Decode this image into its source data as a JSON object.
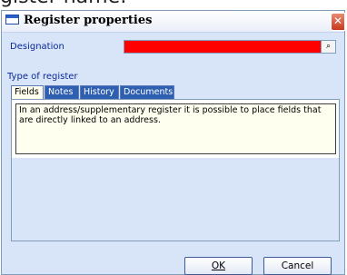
{
  "background_text": "gister name:",
  "window": {
    "title": "Register properties",
    "close_glyph": "✕"
  },
  "form": {
    "designation_label": "Designation",
    "designation_value": "",
    "designation_color": "#ff0000",
    "lookup_glyph": "⌕",
    "type_label": "Type of register"
  },
  "tabs": [
    {
      "label": "Fields",
      "active": true
    },
    {
      "label": "Notes",
      "active": false
    },
    {
      "label": "History",
      "active": false
    },
    {
      "label": "Documents",
      "active": false
    }
  ],
  "fields_text": "In an address/supplementary register it is possible to place fields that are directly linked to an address.",
  "buttons": {
    "ok": "OK",
    "cancel": "Cancel"
  }
}
